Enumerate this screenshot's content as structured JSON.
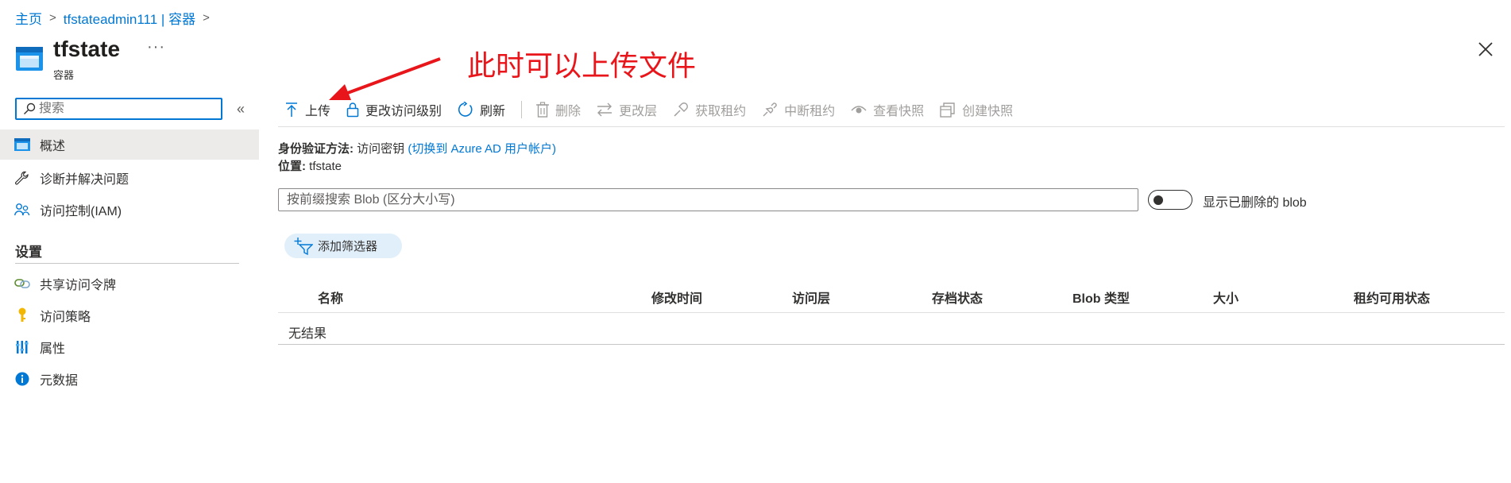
{
  "breadcrumb": {
    "home": "主页",
    "parent": "tfstateadmin111 | 容器"
  },
  "header": {
    "title": "tfstate",
    "subtitle": "容器",
    "more": "···"
  },
  "annotation": "此时可以上传文件",
  "search": {
    "placeholder": "搜索",
    "collapse": "«"
  },
  "sidebar": {
    "items": [
      {
        "label": "概述",
        "icon": "container-icon"
      },
      {
        "label": "诊断并解决问题",
        "icon": "wrench-icon"
      },
      {
        "label": "访问控制(IAM)",
        "icon": "people-icon"
      }
    ],
    "settings_label": "设置",
    "settings_items": [
      {
        "label": "共享访问令牌",
        "icon": "link-icon"
      },
      {
        "label": "访问策略",
        "icon": "key-icon"
      },
      {
        "label": "属性",
        "icon": "properties-icon"
      },
      {
        "label": "元数据",
        "icon": "info-icon"
      }
    ]
  },
  "toolbar": {
    "upload": "上传",
    "change_access": "更改访问级别",
    "refresh": "刷新",
    "delete": "删除",
    "change_tier": "更改层",
    "acquire_lease": "获取租约",
    "break_lease": "中断租约",
    "view_snapshots": "查看快照",
    "create_snapshot": "创建快照"
  },
  "auth": {
    "label": "身份验证方法:",
    "value": "访问密钥",
    "switch_link": "(切换到 Azure AD 用户帐户)",
    "location_label": "位置:",
    "location_value": "tfstate"
  },
  "blob_search": {
    "placeholder": "按前缀搜索 Blob (区分大小写)",
    "toggle_label": "显示已删除的 blob",
    "toggle_on": false
  },
  "filter": {
    "label": "添加筛选器"
  },
  "table": {
    "columns": [
      "名称",
      "修改时间",
      "访问层",
      "存档状态",
      "Blob 类型",
      "大小",
      "租约可用状态"
    ],
    "empty_text": "无结果"
  },
  "colors": {
    "accent": "#0078d4",
    "annotation": "#e8161b",
    "active_bg": "#edebe9",
    "disabled": "#a19f9d"
  }
}
